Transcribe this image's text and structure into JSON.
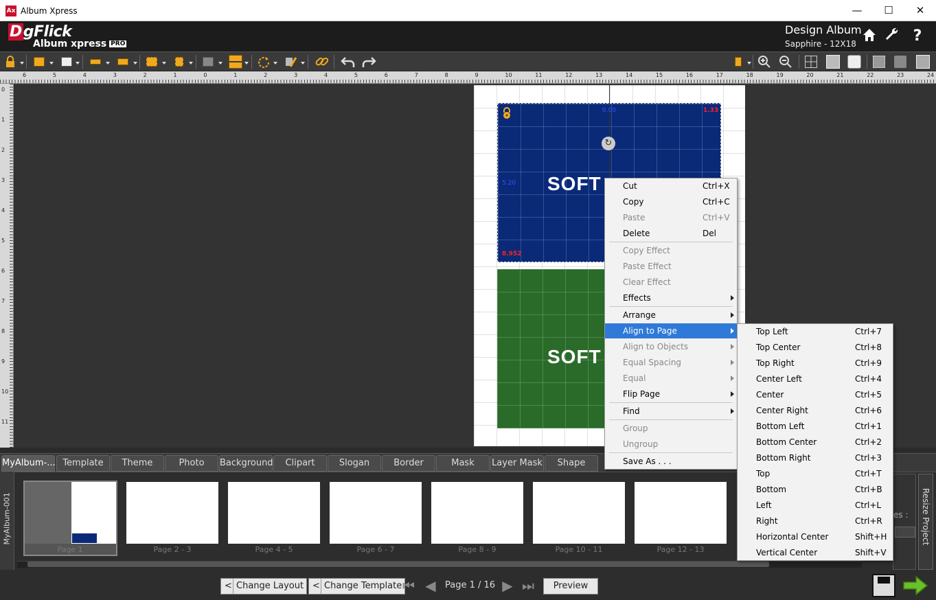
{
  "window": {
    "title": "Album Xpress",
    "app_icon": "Ax",
    "minimize": "—",
    "maximize": "☐",
    "close": "✕"
  },
  "header": {
    "logo_text": "DgFlick",
    "product": "Album xpress",
    "pro_badge": "PRO",
    "title": "Design Album",
    "subtitle": "Sapphire - 12X18"
  },
  "rulers": {
    "h": [
      "6",
      "5",
      "4",
      "3",
      "2",
      "1",
      "0",
      "1",
      "2",
      "3",
      "4",
      "5",
      "6",
      "7",
      "8",
      "9",
      "10",
      "11",
      "12",
      "13",
      "14",
      "15",
      "16",
      "17",
      "18",
      "19",
      "20",
      "21",
      "22",
      "23",
      "24"
    ],
    "v": [
      "0",
      "1",
      "2",
      "3",
      "4",
      "5",
      "6",
      "7",
      "8",
      "9",
      "10",
      "11"
    ]
  },
  "canvas": {
    "watermark": "SOFT",
    "labels": {
      "top_right": "1.33",
      "bottom_left": "8.952",
      "top_center": "0.00",
      "left": "5.20"
    }
  },
  "context_menu": {
    "items": [
      {
        "label": "Cut",
        "shortcut": "Ctrl+X",
        "disabled": false
      },
      {
        "label": "Copy",
        "shortcut": "Ctrl+C",
        "disabled": false
      },
      {
        "label": "Paste",
        "shortcut": "Ctrl+V",
        "disabled": true
      },
      {
        "label": "Delete",
        "shortcut": "Del",
        "disabled": false
      },
      {
        "label": "Copy Effect",
        "disabled": true
      },
      {
        "label": "Paste Effect",
        "disabled": true
      },
      {
        "label": "Clear Effect",
        "disabled": true
      },
      {
        "label": "Effects",
        "submenu": true,
        "disabled": false
      },
      {
        "label": "Arrange",
        "submenu": true,
        "disabled": false
      },
      {
        "label": "Align to Page",
        "submenu": true,
        "highlighted": true
      },
      {
        "label": "Align to Objects",
        "submenu": true,
        "disabled": true
      },
      {
        "label": "Equal Spacing",
        "submenu": true,
        "disabled": true
      },
      {
        "label": "Equal",
        "submenu": true,
        "disabled": true
      },
      {
        "label": "Flip Page",
        "submenu": true,
        "disabled": false
      },
      {
        "label": "Find",
        "submenu": true,
        "disabled": false
      },
      {
        "label": "Group",
        "disabled": true
      },
      {
        "label": "Ungroup",
        "disabled": true
      },
      {
        "label": "Save As . . .",
        "disabled": false
      }
    ]
  },
  "submenu": {
    "items": [
      {
        "label": "Top Left",
        "shortcut": "Ctrl+7"
      },
      {
        "label": "Top Center",
        "shortcut": "Ctrl+8"
      },
      {
        "label": "Top Right",
        "shortcut": "Ctrl+9"
      },
      {
        "label": "Center Left",
        "shortcut": "Ctrl+4"
      },
      {
        "label": "Center",
        "shortcut": "Ctrl+5"
      },
      {
        "label": "Center Right",
        "shortcut": "Ctrl+6"
      },
      {
        "label": "Bottom Left",
        "shortcut": "Ctrl+1"
      },
      {
        "label": "Bottom Center",
        "shortcut": "Ctrl+2"
      },
      {
        "label": "Bottom Right",
        "shortcut": "Ctrl+3"
      },
      {
        "label": "Top",
        "shortcut": "Ctrl+T"
      },
      {
        "label": "Bottom",
        "shortcut": "Ctrl+B"
      },
      {
        "label": "Left",
        "shortcut": "Ctrl+L"
      },
      {
        "label": "Right",
        "shortcut": "Ctrl+R"
      },
      {
        "label": "Horizontal Center",
        "shortcut": "Shift+H"
      },
      {
        "label": "Vertical Center",
        "shortcut": "Shift+V"
      }
    ]
  },
  "tabs": [
    "MyAlbum-...",
    "Template",
    "Theme",
    "Photo",
    "Background",
    "Clipart",
    "Slogan",
    "Border",
    "Mask",
    "Layer Mask",
    "Shape"
  ],
  "filmstrip": {
    "side_label": "MyAlbum-001",
    "pages": [
      "Page 1",
      "Page 2 - 3",
      "Page 4 - 5",
      "Page 6 - 7",
      "Page 8 - 9",
      "Page 10 - 11",
      "Page 12 - 13"
    ],
    "right_label": "es :",
    "resize": "Resize Project"
  },
  "bottom": {
    "change_layout": "Change Layout",
    "change_template": "Change Template",
    "page_info": "Page 1 / 16",
    "preview": "Preview",
    "lt": "<"
  },
  "colors": {
    "accent": "#f0a91e",
    "menu_highlight": "#2f7ad8",
    "blue_frame": "#0a2a78",
    "green_frame": "#2a6b2a"
  }
}
